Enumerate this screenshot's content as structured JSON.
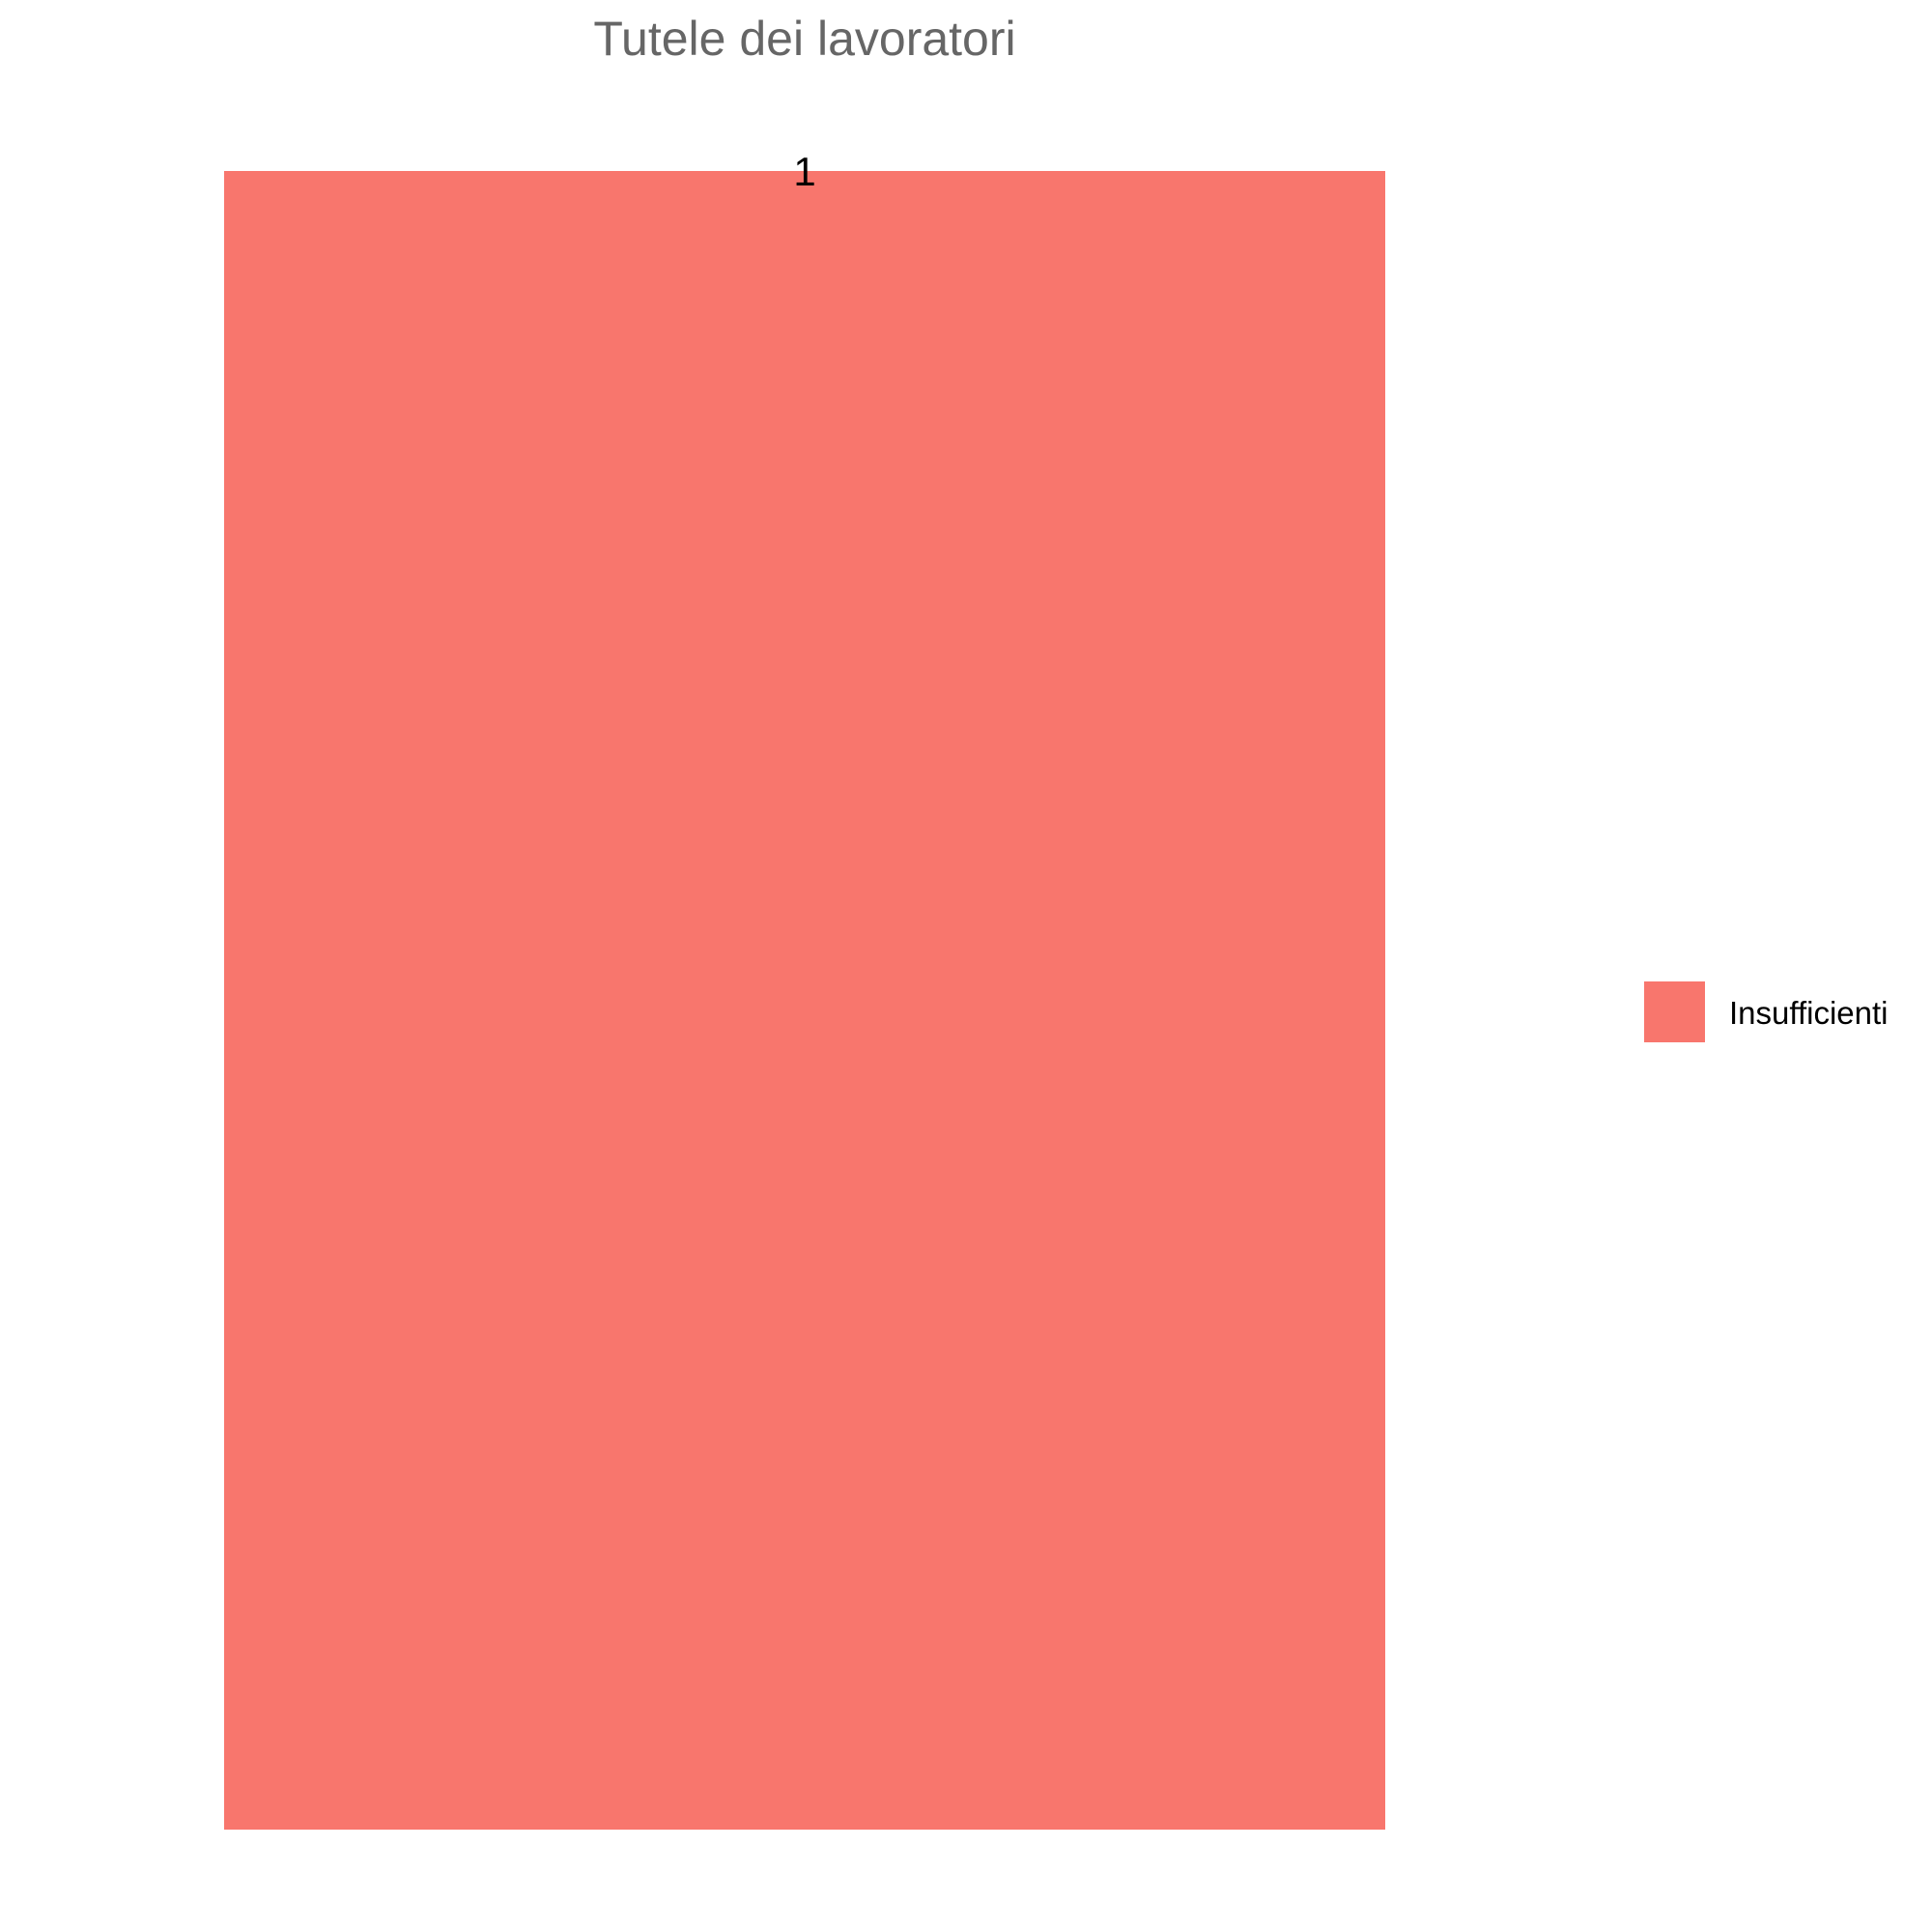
{
  "chart_data": {
    "type": "bar",
    "title": "Tutele dei lavoratori",
    "categories": [
      "Insufficienti"
    ],
    "values": [
      1
    ],
    "data_labels": [
      "1"
    ],
    "ylim": [
      0,
      1
    ],
    "grid": false,
    "stacked": true,
    "legend": {
      "placement": "right",
      "entries": [
        {
          "label": "Insufficienti",
          "color": "#F8766D"
        }
      ]
    },
    "colors": {
      "Insufficienti": "#F8766D"
    }
  }
}
